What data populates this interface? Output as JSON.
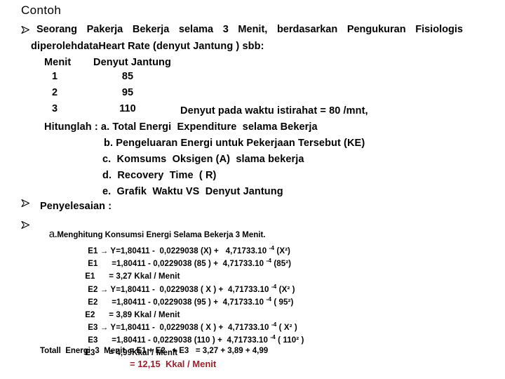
{
  "slide": {
    "title": "Contoh",
    "accent_red": "#9C2029",
    "text_color": "#000000",
    "background": "#FFFFFF"
  },
  "bullets": {
    "marker_name": "wingdings-arrow-bullet",
    "marker_glyph": "Ø"
  },
  "problem": {
    "line1_words": [
      "Seorang",
      "Pakerja",
      "Bekerja",
      "selama",
      "3",
      "Menit,",
      "berdasarkan",
      "Pengukuran",
      "Fisiologis"
    ],
    "line2": "diperolehdataHeart Rate (denyut Jantung ) sbb:",
    "table": {
      "header_minute": "Menit",
      "header_beat": "Denyut Jantung",
      "rows": [
        {
          "minute": "1",
          "beat": "85"
        },
        {
          "minute": "2",
          "beat": "95"
        },
        {
          "minute": "3",
          "beat": "110"
        }
      ],
      "resting_note": "Denyut pada waktu istirahat = 80 /mnt,"
    },
    "questions_intro": "Hitunglah : a. Total Energi  Expenditure  selama Bekerja",
    "questions": [
      "b. Pengeluaran Energi untuk Pekerjaan Tersebut (KE)",
      "c.  Komsums  Oksigen (A)  slama bekerja",
      "d.  Recovery  Time  ( R)",
      "e.  Grafik  Waktu VS  Denyut Jantung"
    ]
  },
  "solution": {
    "heading": "Penyelesaian :",
    "section_a_prefix": "a",
    "section_a_title": ".Menghitung Konsumsi Energi Selama Bekerja 3 Menit.",
    "equations": [
      {
        "label": "E1 → Y",
        "body": "=1,80411 -  0,0229038 (X) +   4,71733.10 ",
        "exp": "-4",
        "tail": " (X²)"
      },
      {
        "label": "E1",
        "body": "      =1,80411 - 0,0229038 (85 ) +  4,71733.10 ",
        "exp": "-4",
        "tail": " (85²)"
      },
      {
        "label": "E1",
        "body": "      = 3,27 Kkal / Menit",
        "exp": "",
        "tail": ""
      },
      {
        "label": "E2 → Y",
        "body": "=1,80411 -  0,0229038 ( X ) +  4,71733.10 ",
        "exp": "-4",
        "tail": " (X² )"
      },
      {
        "label": "E2",
        "body": "      =1,80411 - 0,0229038 (95 ) +  4,71733.10 ",
        "exp": "-4",
        "tail": " ( 95²)"
      },
      {
        "label": "E2",
        "body": "      = 3,89 Kkal / Menit",
        "exp": "",
        "tail": ""
      },
      {
        "label": "E3 → Y",
        "body": "=1,80411 -  0,0229038 ( X ) +  4,71733.10 ",
        "exp": "-4",
        "tail": " ( X² )"
      },
      {
        "label": "E3",
        "body": "      =1,80411 - 0,0229038 (110 ) +  4,71733.10 ",
        "exp": "-4",
        "tail": " ( 110² )"
      },
      {
        "label": "E3",
        "body": "      = 4,99Kkal / Menit",
        "exp": "",
        "tail": ""
      }
    ],
    "total_line": "Totall  Energi  3  Menit  = E1 + E2   + E3   = 3,27 + 3,89 + 4,99",
    "result_line": "= 12,15  Kkal / Menit"
  }
}
